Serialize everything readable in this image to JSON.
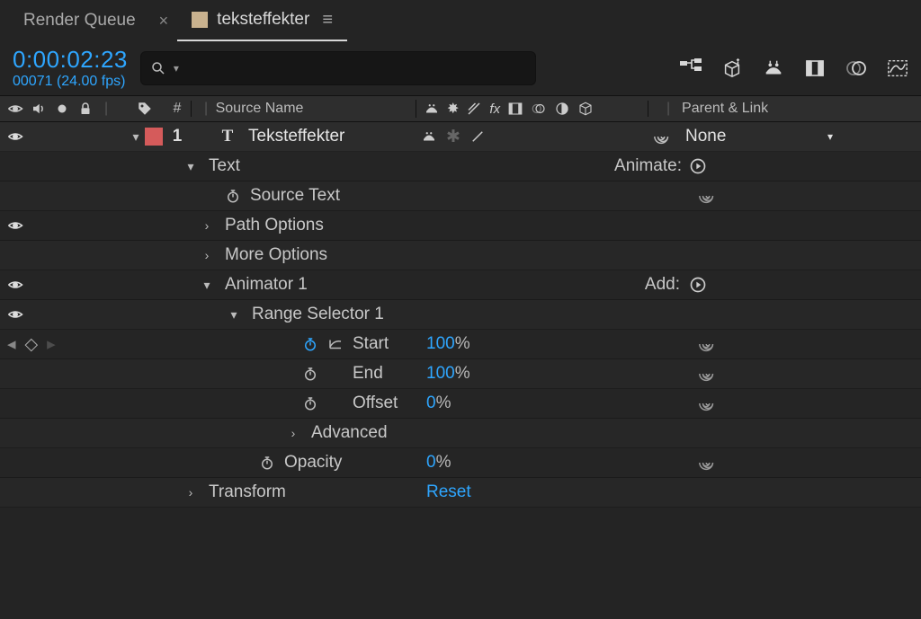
{
  "tabs": {
    "render_queue": "Render Queue",
    "comp_name": "teksteffekter"
  },
  "time": {
    "timecode": "0:00:02:23",
    "frames": "00071 (24.00 fps)"
  },
  "search": {
    "placeholder": ""
  },
  "columns": {
    "num": "#",
    "source_name": "Source Name",
    "parent_link": "Parent & Link"
  },
  "layer": {
    "index": "1",
    "name": "Teksteffekter",
    "parent": "None"
  },
  "text_group": {
    "label": "Text",
    "animate": "Animate:",
    "source_text": "Source Text",
    "path_options": "Path Options",
    "more_options": "More Options"
  },
  "animator": {
    "label": "Animator 1",
    "add": "Add:"
  },
  "range_selector": {
    "label": "Range Selector 1",
    "start_label": "Start",
    "start_value": "100",
    "start_unit": "%",
    "end_label": "End",
    "end_value": "100",
    "end_unit": "%",
    "offset_label": "Offset",
    "offset_value": "0",
    "offset_unit": "%",
    "advanced": "Advanced"
  },
  "opacity": {
    "label": "Opacity",
    "value": "0",
    "unit": "%"
  },
  "transform": {
    "label": "Transform",
    "reset": "Reset"
  }
}
